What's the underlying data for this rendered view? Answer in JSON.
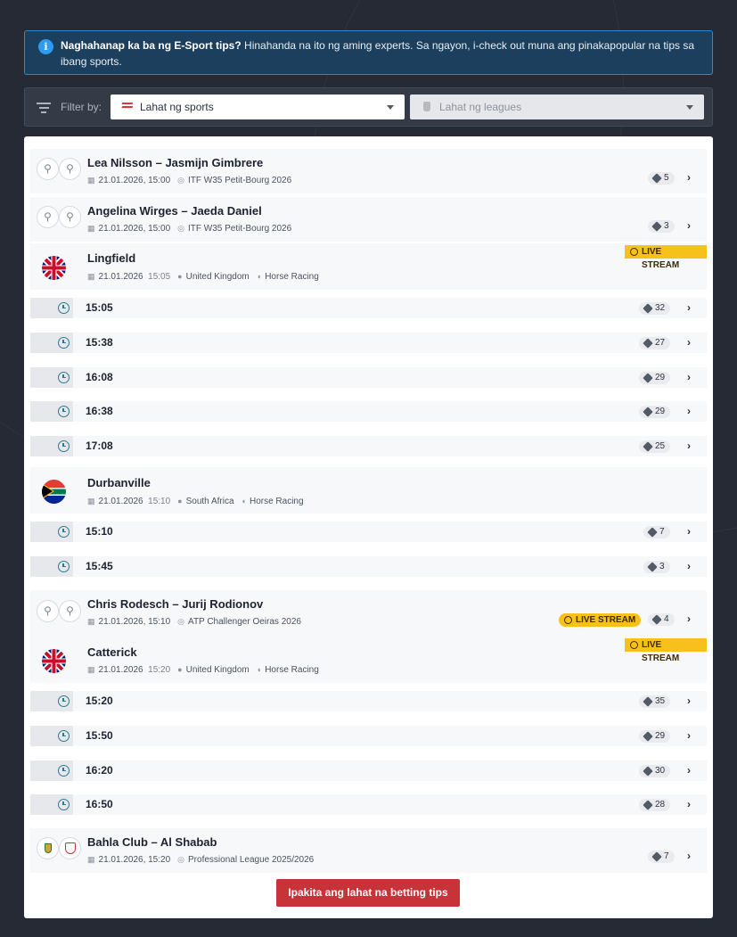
{
  "info_banner": {
    "bold": "Naghahanap ka ba ng E-Sport tips?",
    "text": " Hinahanda na ito ng aming experts. Sa ngayon, i-check out muna ang pinakapopular na tips sa ibang sports."
  },
  "filter": {
    "label": "Filter by:",
    "sports_value": "Lahat ng sports",
    "leagues_value": "Lahat ng leagues"
  },
  "live_label": "LIVE STREAM",
  "events": {
    "m1": {
      "team_a": "Lea Nilsson",
      "sep": "–",
      "team_b": "Jasmijn Gimbrere",
      "datetime": "21.01.2026, 15:00",
      "league": "ITF W35 Petit-Bourg 2026",
      "tips": "5"
    },
    "m2": {
      "team_a": "Angelina Wirges",
      "sep": "–",
      "team_b": "Jaeda Daniel",
      "datetime": "21.01.2026, 15:00",
      "league": "ITF W35 Petit-Bourg 2026",
      "tips": "3"
    },
    "r1": {
      "venue": "Lingfield",
      "date": "21.01.2026",
      "time": "15:05",
      "country": "United Kingdom",
      "sport": "Horse Racing",
      "races": [
        {
          "time": "15:05",
          "tips": "32"
        },
        {
          "time": "15:38",
          "tips": "27"
        },
        {
          "time": "16:08",
          "tips": "29"
        },
        {
          "time": "16:38",
          "tips": "29"
        },
        {
          "time": "17:08",
          "tips": "25"
        }
      ]
    },
    "r2": {
      "venue": "Durbanville",
      "date": "21.01.2026",
      "time": "15:10",
      "country": "South Africa",
      "sport": "Horse Racing",
      "races": [
        {
          "time": "15:10",
          "tips": "7"
        },
        {
          "time": "15:45",
          "tips": "3"
        }
      ]
    },
    "m3": {
      "team_a": "Chris Rodesch",
      "sep": "–",
      "team_b": "Jurij Rodionov",
      "datetime": "21.01.2026, 15:10",
      "league": "ATP Challenger Oeiras 2026",
      "tips": "4"
    },
    "r3": {
      "venue": "Catterick",
      "date": "21.01.2026",
      "time": "15:20",
      "country": "United Kingdom",
      "sport": "Horse Racing",
      "races": [
        {
          "time": "15:20",
          "tips": "35"
        },
        {
          "time": "15:50",
          "tips": "29"
        },
        {
          "time": "16:20",
          "tips": "30"
        },
        {
          "time": "16:50",
          "tips": "28"
        }
      ]
    },
    "m4": {
      "team_a": "Bahla Club",
      "sep": "–",
      "team_b": "Al Shabab",
      "datetime": "21.01.2026, 15:20",
      "league": "Professional League 2025/2026",
      "tips": "7"
    }
  },
  "show_all_label": "Ipakita ang lahat na betting tips",
  "colors": {
    "live": "#f7c01a",
    "button": "#c8333a",
    "info_border": "#2f88cf"
  }
}
